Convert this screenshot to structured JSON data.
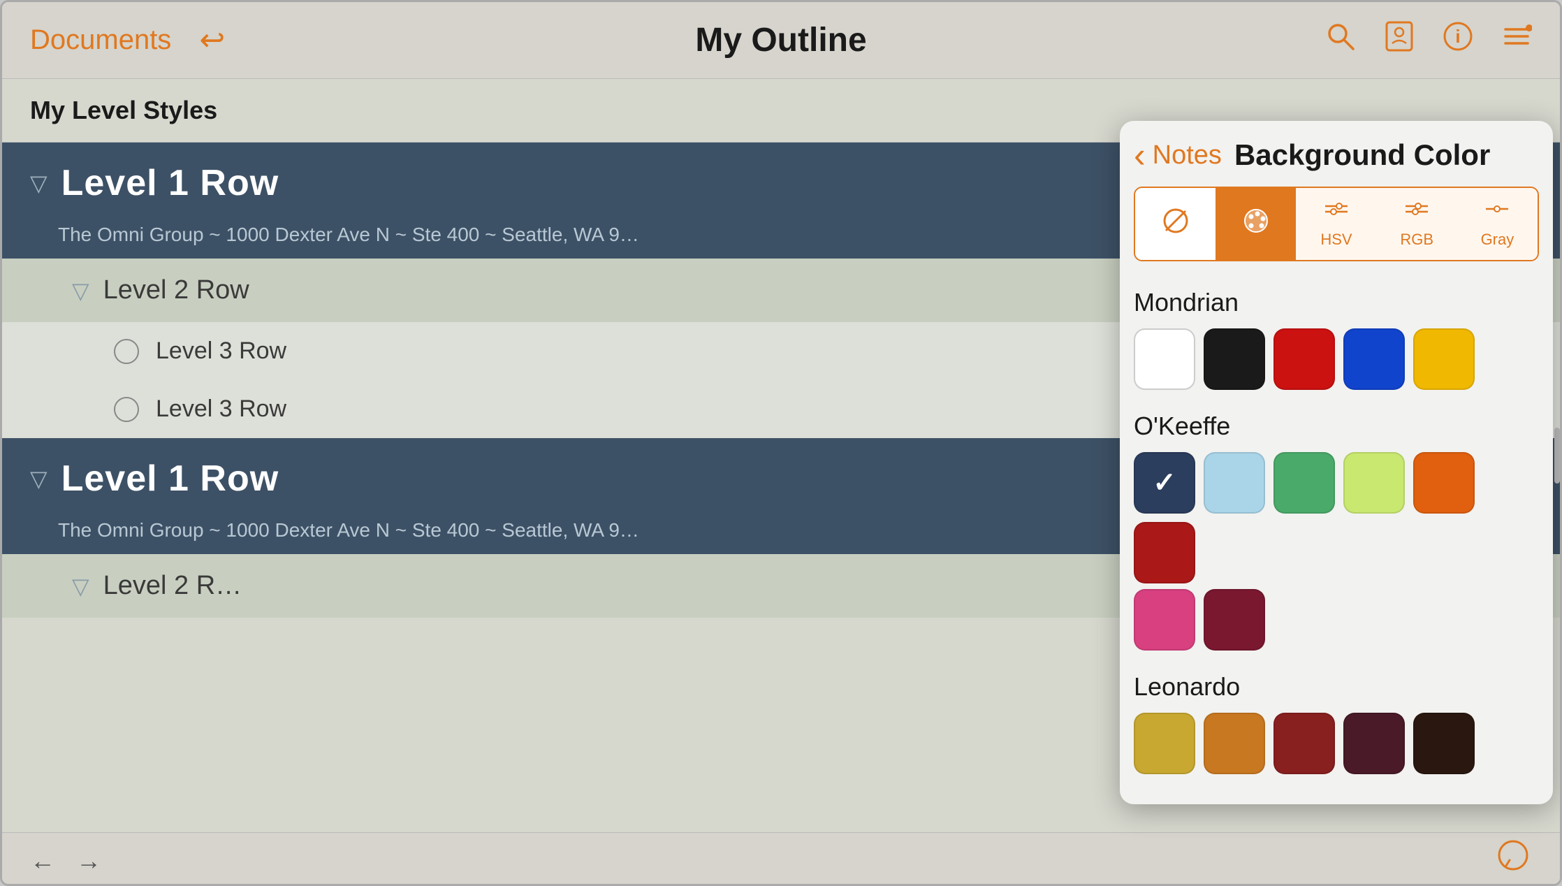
{
  "header": {
    "documents_label": "Documents",
    "title": "My Outline",
    "back_symbol": "↩",
    "search_symbol": "⌕",
    "style_symbol": "🖼",
    "info_symbol": "ⓘ",
    "menu_symbol": "≡"
  },
  "outline": {
    "section_title": "My Level Styles",
    "rows": [
      {
        "type": "level1",
        "label": "Level 1 Row",
        "sub": "The Omni Group ~ 1000 Dexter Ave N ~ Ste 400 ~ Seattle, WA 9…"
      },
      {
        "type": "level2",
        "label": "Level 2 Row"
      },
      {
        "type": "level3",
        "label": "Level 3 Row"
      },
      {
        "type": "level3",
        "label": "Level 3 Row"
      },
      {
        "type": "level1",
        "label": "Level 1 Row",
        "sub": "The Omni Group ~ 1000 Dexter Ave N ~ Ste 400 ~ Seattle, WA 9…"
      },
      {
        "type": "level2-partial",
        "label": "Level 2 R…"
      }
    ]
  },
  "bottom_toolbar": {
    "prev_arrow": "←",
    "next_arrow": "→",
    "comment_icon": "💬"
  },
  "color_picker": {
    "back_arrow": "‹",
    "notes_label": "Notes",
    "title": "Background Color",
    "tabs": [
      {
        "id": "none",
        "icon": "⊘",
        "label": "",
        "active": false
      },
      {
        "id": "palette",
        "icon": "🎨",
        "label": "",
        "active": true
      },
      {
        "id": "hsv",
        "icon": "⊟",
        "label": "HSV",
        "active": false
      },
      {
        "id": "rgb",
        "icon": "⊟",
        "label": "RGB",
        "active": false
      },
      {
        "id": "gray",
        "icon": "⊟",
        "label": "Gray",
        "active": false
      }
    ],
    "sections": [
      {
        "title": "Mondrian",
        "swatches": [
          {
            "color": "#ffffff",
            "selected": false
          },
          {
            "color": "#1a1a1a",
            "selected": false
          },
          {
            "color": "#cc1111",
            "selected": false
          },
          {
            "color": "#1144cc",
            "selected": false
          },
          {
            "color": "#f0b800",
            "selected": false
          }
        ]
      },
      {
        "title": "O'Keeffe",
        "swatches": [
          {
            "color": "#2c3e5e",
            "selected": true
          },
          {
            "color": "#aad4e8",
            "selected": false
          },
          {
            "color": "#4aaa6a",
            "selected": false
          },
          {
            "color": "#c8e870",
            "selected": false
          },
          {
            "color": "#e06010",
            "selected": false
          },
          {
            "color": "#aa1818",
            "selected": false
          },
          {
            "color": "#d84080",
            "selected": false
          },
          {
            "color": "#7a1830",
            "selected": false
          }
        ]
      },
      {
        "title": "Leonardo",
        "swatches": [
          {
            "color": "#c8a830",
            "selected": false
          },
          {
            "color": "#c87820",
            "selected": false
          },
          {
            "color": "#882020",
            "selected": false
          },
          {
            "color": "#4a1a28",
            "selected": false
          },
          {
            "color": "#2a1810",
            "selected": false
          }
        ]
      }
    ]
  }
}
